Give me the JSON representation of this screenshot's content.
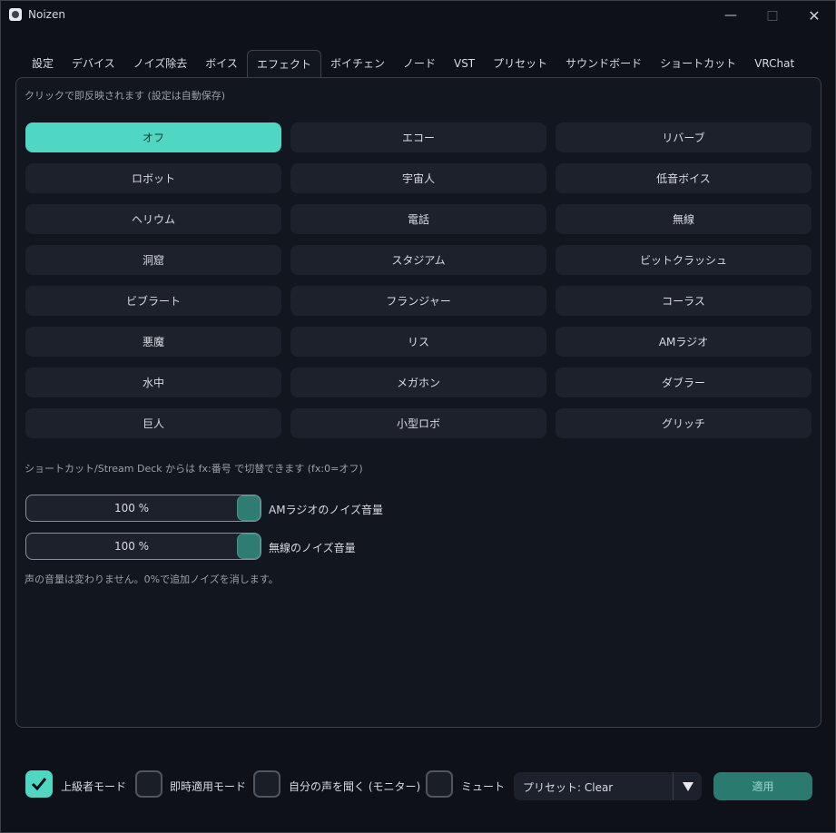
{
  "window": {
    "title": "Noizen"
  },
  "tabs": [
    "設定",
    "デバイス",
    "ノイズ除去",
    "ボイス",
    "エフェクト",
    "ボイチェン",
    "ノード",
    "VST",
    "プリセット",
    "サウンドボード",
    "ショートカット",
    "VRChat"
  ],
  "active_tab": "エフェクト",
  "effects": {
    "hint": "クリックで即反映されます (設定は自動保存)",
    "buttons": [
      "オフ",
      "エコー",
      "リバーブ",
      "ロボット",
      "宇宙人",
      "低音ボイス",
      "ヘリウム",
      "電話",
      "無線",
      "洞窟",
      "スタジアム",
      "ビットクラッシュ",
      "ビブラート",
      "フランジャー",
      "コーラス",
      "悪魔",
      "リス",
      "AMラジオ",
      "水中",
      "メガホン",
      "ダブラー",
      "巨人",
      "小型ロボ",
      "グリッチ"
    ],
    "selected": "オフ",
    "shortcut_note": "ショートカット/Stream Deck からは fx:番号 で切替できます (fx:0=オフ)"
  },
  "sliders": {
    "am_radio": {
      "value_text": "100 %",
      "value": 100,
      "label": "AMラジオのノイズ音量"
    },
    "radio": {
      "value_text": "100 %",
      "value": 100,
      "label": "無線のノイズ音量"
    },
    "note": "声の音量は変わりません。0%で追加ノイズを消します。"
  },
  "footer": {
    "advanced_mode": {
      "label": "上級者モード",
      "checked": true
    },
    "instant_apply": {
      "label": "即時適用モード",
      "checked": false
    },
    "monitor": {
      "label": "自分の声を聞く (モニター)",
      "checked": false
    },
    "mute": {
      "label": "ミュート",
      "checked": false
    },
    "preset": "プリセット: Clear",
    "apply_label": "適用"
  },
  "colors": {
    "accent": "#4fd7c4",
    "background": "#0e1118",
    "button": "#1c212b",
    "apply": "#2a7a70"
  }
}
